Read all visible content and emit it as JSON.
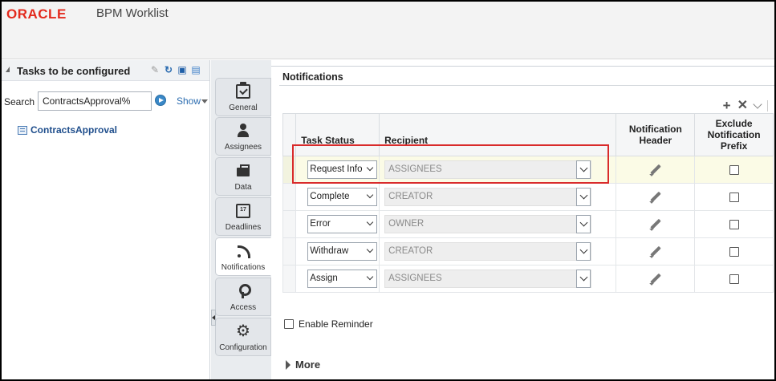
{
  "header": {
    "logo": "ORACLE",
    "app_title": "BPM Worklist"
  },
  "left_panel": {
    "title": "Tasks to be configured",
    "search_label": "Search",
    "search_value": "ContractsApproval%",
    "show_label": "Show",
    "tasks": [
      "ContractsApproval"
    ]
  },
  "tabs": [
    {
      "label": "General",
      "icon": "clipboard-check-icon"
    },
    {
      "label": "Assignees",
      "icon": "person-icon"
    },
    {
      "label": "Data",
      "icon": "briefcase-icon"
    },
    {
      "label": "Deadlines",
      "icon": "calendar-icon",
      "day": "17"
    },
    {
      "label": "Notifications",
      "icon": "rss-icon",
      "active": true
    },
    {
      "label": "Access",
      "icon": "keys-icon"
    },
    {
      "label": "Configuration",
      "icon": "gear-icon"
    }
  ],
  "notifications": {
    "section_title": "Notifications",
    "columns": {
      "task_status": "Task Status",
      "recipient": "Recipient",
      "notification_header": "Notification Header",
      "exclude_prefix": "Exclude Notification Prefix"
    },
    "rows": [
      {
        "status": "Request Info",
        "recipient": "ASSIGNEES"
      },
      {
        "status": "Complete",
        "recipient": "CREATOR"
      },
      {
        "status": "Error",
        "recipient": "OWNER"
      },
      {
        "status": "Withdraw",
        "recipient": "CREATOR"
      },
      {
        "status": "Assign",
        "recipient": "ASSIGNEES"
      }
    ],
    "enable_reminder": "Enable Reminder",
    "more": "More"
  },
  "colors": {
    "oracle_red": "#e32a1d",
    "highlight": "#d92b2b",
    "link": "#2b6cb0"
  }
}
